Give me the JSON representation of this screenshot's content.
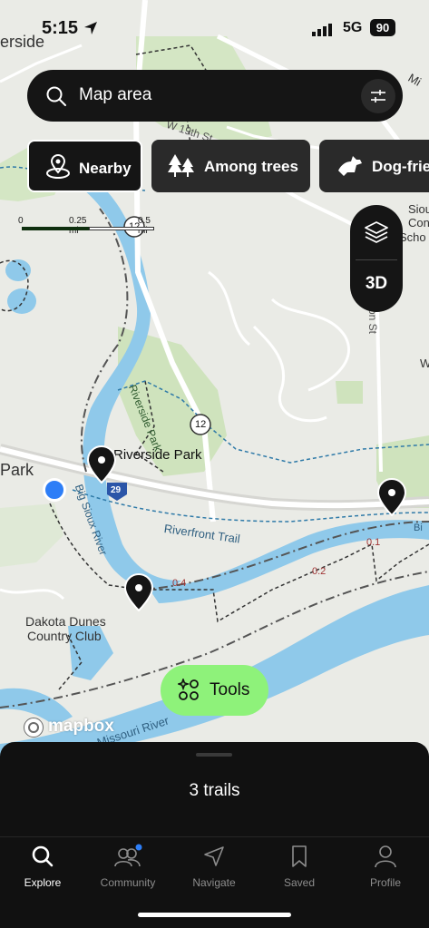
{
  "status": {
    "time": "5:15",
    "network": "5G",
    "battery": "90"
  },
  "search": {
    "placeholder": "Map area"
  },
  "chips": [
    {
      "label": "Nearby",
      "icon": "location-pin-icon",
      "active": true
    },
    {
      "label": "Among trees",
      "icon": "trees-icon",
      "active": false
    },
    {
      "label": "Dog-frie",
      "icon": "dog-icon",
      "active": false
    }
  ],
  "scale": {
    "zero": "0",
    "quarter": "0.25 mi",
    "half": "0.5 mi"
  },
  "layers": {
    "three_d_label": "3D",
    "icon": "layers-icon"
  },
  "map": {
    "labels": {
      "riverside_top": "erside",
      "park_left": "Park",
      "riverside_park": "Riverside Park",
      "riverside_park_road": "Riverside Park",
      "big_sioux_river": "Big Sioux River",
      "riverfront_trail": "Riverfront Trail",
      "missouri_river": "Missouri River",
      "dakota_dunes": "Dakota Dunes",
      "country_club": "Country Club",
      "sioux": "Sioux",
      "con": "Con",
      "scho": "Scho",
      "w19th": "W 19th St",
      "on_st": "on St",
      "w_label": "W",
      "mi_label": "Mi",
      "dist_04": "0.4",
      "dist_02": "0.2",
      "dist_01": "0.1",
      "route_12": "12",
      "route_12b": "12",
      "route_29": "29",
      "bi_label": "Bi"
    }
  },
  "tools": {
    "label": "Tools"
  },
  "attribution": {
    "label": "mapbox"
  },
  "sheet": {
    "trail_count": "3 trails"
  },
  "tabs": [
    {
      "label": "Explore",
      "icon": "search-icon",
      "active": true
    },
    {
      "label": "Community",
      "icon": "community-icon",
      "active": false
    },
    {
      "label": "Navigate",
      "icon": "navigate-icon",
      "active": false
    },
    {
      "label": "Saved",
      "icon": "bookmark-icon",
      "active": false
    },
    {
      "label": "Profile",
      "icon": "profile-icon",
      "active": false
    }
  ],
  "colors": {
    "accent_green": "#8ef27a",
    "water": "#8fc9ea",
    "park": "#c6dfb3",
    "user_location": "#2d7ef7"
  }
}
